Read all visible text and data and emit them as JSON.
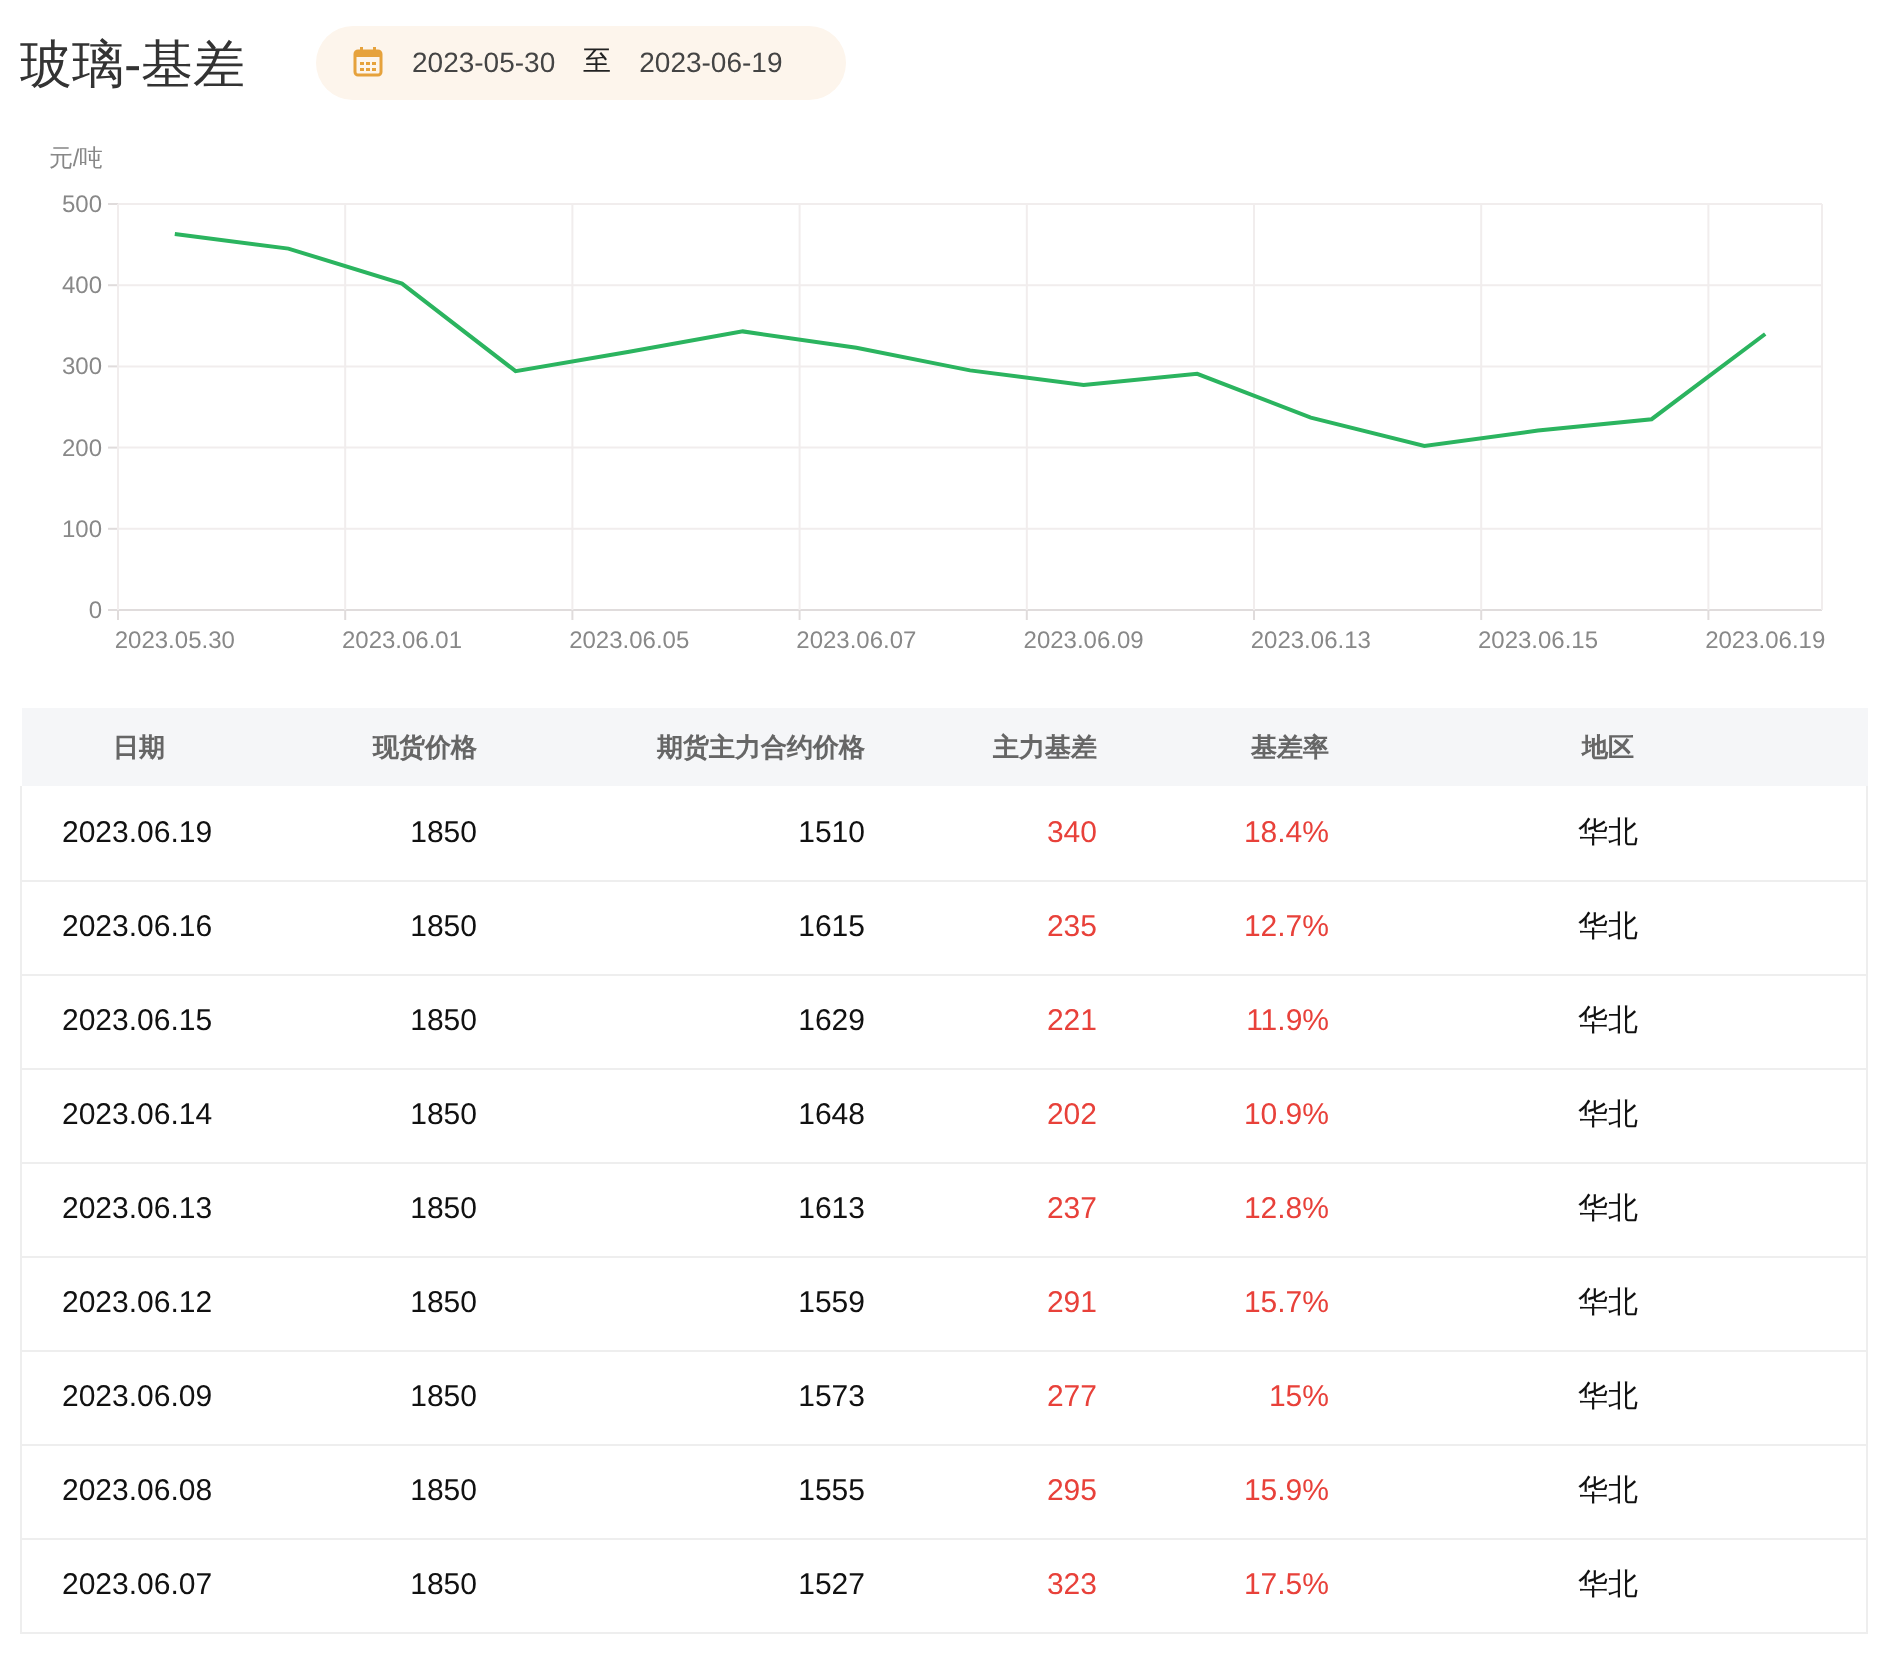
{
  "title": "玻璃-基差",
  "date_range": {
    "start": "2023-05-30",
    "separator": "至",
    "end": "2023-06-19"
  },
  "chart_data": {
    "type": "line",
    "ylabel": "元/吨",
    "categories": [
      "2023.05.30",
      null,
      "2023.06.01",
      null,
      "2023.06.05",
      null,
      "2023.06.07",
      null,
      "2023.06.09",
      null,
      "2023.06.13",
      null,
      "2023.06.15",
      null,
      "2023.06.19"
    ],
    "series": [
      {
        "color": "#2bb45f",
        "values": [
          463,
          445,
          402,
          294,
          318,
          343,
          323,
          295,
          277,
          291,
          237,
          202,
          221,
          235,
          340
        ]
      }
    ],
    "ylim": [
      0,
      500
    ],
    "yticks": [
      0,
      100,
      200,
      300,
      400,
      500
    ],
    "grid": true
  },
  "table": {
    "columns": [
      "日期",
      "现货价格",
      "期货主力合约价格",
      "主力基差",
      "基差率",
      "地区"
    ],
    "rows": [
      [
        "2023.06.19",
        "1850",
        "1510",
        "340",
        "18.4%",
        "华北"
      ],
      [
        "2023.06.16",
        "1850",
        "1615",
        "235",
        "12.7%",
        "华北"
      ],
      [
        "2023.06.15",
        "1850",
        "1629",
        "221",
        "11.9%",
        "华北"
      ],
      [
        "2023.06.14",
        "1850",
        "1648",
        "202",
        "10.9%",
        "华北"
      ],
      [
        "2023.06.13",
        "1850",
        "1613",
        "237",
        "12.8%",
        "华北"
      ],
      [
        "2023.06.12",
        "1850",
        "1559",
        "291",
        "15.7%",
        "华北"
      ],
      [
        "2023.06.09",
        "1850",
        "1573",
        "277",
        "15%",
        "华北"
      ],
      [
        "2023.06.08",
        "1850",
        "1555",
        "295",
        "15.9%",
        "华北"
      ],
      [
        "2023.06.07",
        "1850",
        "1527",
        "323",
        "17.5%",
        "华北"
      ]
    ]
  }
}
